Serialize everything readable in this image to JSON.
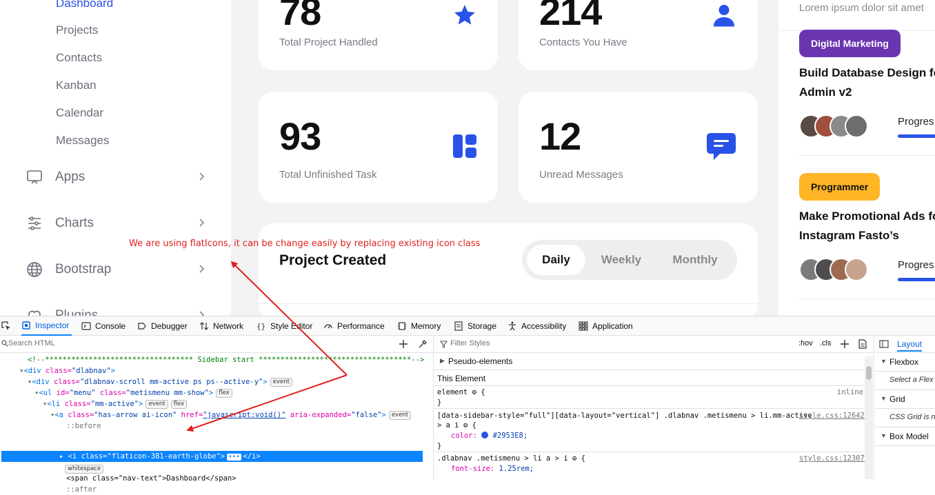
{
  "sidebar": {
    "sub_items": [
      {
        "label": "Dashboard",
        "active": true
      },
      {
        "label": "Projects"
      },
      {
        "label": "Contacts"
      },
      {
        "label": "Kanban"
      },
      {
        "label": "Calendar"
      },
      {
        "label": "Messages"
      }
    ],
    "nav_items": [
      {
        "label": "Apps",
        "icon": "monitor-icon"
      },
      {
        "label": "Charts",
        "icon": "sliders-icon"
      },
      {
        "label": "Bootstrap",
        "icon": "globe-icon"
      },
      {
        "label": "Plugins",
        "icon": "heart-icon"
      }
    ]
  },
  "stats": [
    {
      "value": "78",
      "label": "Total Project Handled",
      "icon": "star-icon"
    },
    {
      "value": "214",
      "label": "Contacts You Have",
      "icon": "user-icon"
    },
    {
      "value": "93",
      "label": "Total Unfinished Task",
      "icon": "dashboard-icon"
    },
    {
      "value": "12",
      "label": "Unread Messages",
      "icon": "message-icon"
    }
  ],
  "project_created": {
    "title": "Project Created",
    "tabs": [
      "Daily",
      "Weekly",
      "Monthly"
    ],
    "active_tab": "Daily"
  },
  "right_panel": {
    "lorem": "Lorem ipsum dolor sit amet",
    "projects": [
      {
        "tag": "Digital Marketing",
        "tag_color": "#6a35b0",
        "title_line1": "Build Database Design fo",
        "title_line2": "Admin v2",
        "progress_label": "Progres"
      },
      {
        "tag": "Programmer",
        "tag_color": "#ffb526",
        "title_line1": "Make Promotional Ads fo",
        "title_line2": "Instagram Fasto’s",
        "progress_label": "Progres"
      }
    ]
  },
  "annotation": "We are using flatIcons, it can be change easily by replacing existing icon class",
  "devtools": {
    "tabs": [
      "Inspector",
      "Console",
      "Debugger",
      "Network",
      "Style Editor",
      "Performance",
      "Memory",
      "Storage",
      "Accessibility",
      "Application"
    ],
    "active_tab": "Inspector",
    "search_placeholder": "Search HTML",
    "html_lines": {
      "comment": "<!--********************************** Sidebar start ***********************************-->",
      "l1_tag": "<div ",
      "l1_attr": "class=",
      "l1_val": "\"dlabnav\"",
      "l1_end": ">",
      "l2_tag": "<div ",
      "l2_attr": "class=",
      "l2_val": "\"dlabnav-scroll mm-active ps ps--active-y\"",
      "l2_end": ">",
      "l2_badge": "event",
      "l3_tag": "<ul ",
      "l3_attr1": "id=",
      "l3_val1": "\"menu\"",
      "l3_attr2": " class=",
      "l3_val2": "\"metismenu mm-show\"",
      "l3_end": ">",
      "l3_badge": "flex",
      "l4_tag": "<li ",
      "l4_attr": "class=",
      "l4_val": "\"mm-active\"",
      "l4_end": ">",
      "l4_badge1": "event",
      "l4_badge2": "flex",
      "l5_tag": "<a ",
      "l5_attr1": "class=",
      "l5_val1": "\"has-arrow ai-icon\"",
      "l5_attr2": " href=",
      "l5_val2": "\"javascript:void()\"",
      "l5_attr3": " aria-expanded=",
      "l5_val3": "\"false\"",
      "l5_end": ">",
      "l5_badge": "event",
      "before": "::before",
      "selected": "<i class=\"flaticon-381-earth-globe\">",
      "selected_tail": "</i>",
      "whitespace": "whitespace",
      "span_line": "<span class=\"nav-text\">Dashboard</span>",
      "after": "::after"
    },
    "styles": {
      "filter_placeholder": "Filter Styles",
      "hov": ":hov",
      "cls": ".cls",
      "pseudo": "Pseudo-elements",
      "this_element": "This Element",
      "r1_sel": "element",
      "r1_src": "inline",
      "r1_close": "}",
      "r2_sel": "[data-sidebar-style=\"full\"][data-layout=\"vertical\"] .dlabnav .metismenu > li.mm-active",
      "r2_sel2": "> a i",
      "r2_src": "style.css:12642",
      "r2_prop": "color:",
      "r2_val": "#2953E8;",
      "r2_color": "#2953E8",
      "r2_close": "}",
      "r3_sel": ".dlabnav .metismenu > li a > i",
      "r3_src": "style.css:12307",
      "r3_prop": "font-size:",
      "r3_val": "1.25rem;"
    },
    "layout_panel": {
      "tab": "Layout",
      "flexbox": "Flexbox",
      "flex_hint": "Select a Flex",
      "grid": "Grid",
      "grid_hint": "CSS Grid is n",
      "box_model": "Box Model"
    }
  }
}
